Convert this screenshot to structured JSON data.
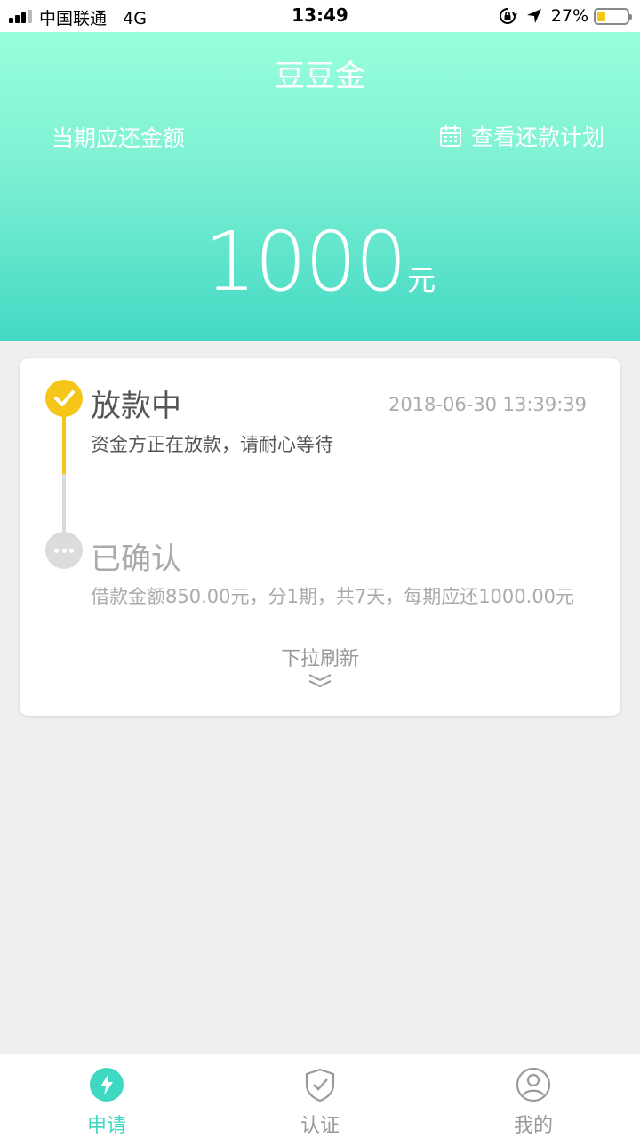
{
  "status_bar": {
    "carrier": "中国联通",
    "network": "4G",
    "time": "13:49",
    "battery_percent": "27%",
    "battery_level": 0.27
  },
  "header": {
    "title": "豆豆金",
    "due_label": "当期应还金额",
    "plan_link": "查看还款计划",
    "amount": "1000",
    "unit": "元"
  },
  "timeline": {
    "steps": [
      {
        "title": "放款中",
        "time": "2018-06-30 13:39:39",
        "desc": "资金方正在放款，请耐心等待",
        "status": "done"
      },
      {
        "title": "已确认",
        "desc": "借款金额850.00元，分1期，共7天，每期应还1000.00元",
        "status": "pending"
      }
    ],
    "refresh_label": "下拉刷新"
  },
  "tab_bar": {
    "tabs": [
      {
        "label": "申请",
        "icon": "lightning-icon",
        "active": true
      },
      {
        "label": "认证",
        "icon": "shield-check-icon",
        "active": false
      },
      {
        "label": "我的",
        "icon": "user-icon",
        "active": false
      }
    ]
  },
  "colors": {
    "accent": "#3fd8c2",
    "header_top": "#98ffdd",
    "header_bottom": "#43d9c4",
    "step_done": "#f5c518",
    "step_pending": "#dcdcdc"
  }
}
